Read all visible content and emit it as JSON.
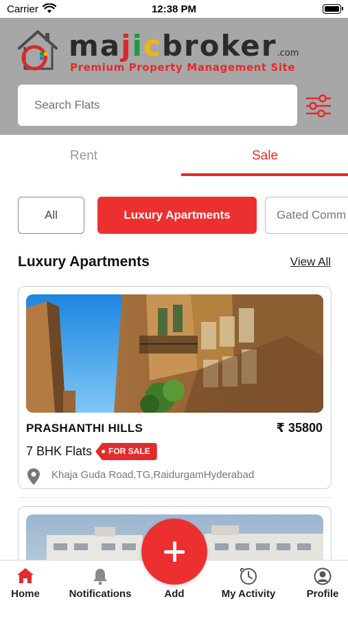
{
  "status_bar": {
    "carrier": "Carrier",
    "time": "12:38 PM"
  },
  "brand": {
    "name_parts": [
      "m",
      "a",
      "j",
      "i",
      "c",
      "broker"
    ],
    "name_a": "ma",
    "name_j": "j",
    "name_i": "i",
    "name_c": "c",
    "name_broker": "broker",
    "dotcom": ".com",
    "tagline": "Premium Property Management Site"
  },
  "search": {
    "placeholder": "Search Flats",
    "value": ""
  },
  "tabs": [
    {
      "label": "Rent",
      "active": false
    },
    {
      "label": "Sale",
      "active": true
    }
  ],
  "categories": [
    {
      "label": "All",
      "active": false
    },
    {
      "label": "Luxury Apartments",
      "active": true
    },
    {
      "label": "Gated Comm",
      "active": false
    }
  ],
  "section": {
    "title": "Luxury Apartments",
    "view_all": "View All"
  },
  "listing": {
    "name": "PRASHANTHI HILLS",
    "price": "₹ 35800",
    "type": "7 BHK Flats",
    "badge": "FOR SALE",
    "location": "Khaja Guda Road,TG,RaidurgamHyderabad"
  },
  "bottom_nav": [
    {
      "label": "Home",
      "icon": "home-icon",
      "active": true
    },
    {
      "label": "Notifications",
      "icon": "bell-icon",
      "active": false
    },
    {
      "label": "Add",
      "icon": "plus-icon",
      "active": false
    },
    {
      "label": "My Activity",
      "icon": "activity-clock-icon",
      "active": false
    },
    {
      "label": "Profile",
      "icon": "user-icon",
      "active": false
    }
  ],
  "colors": {
    "accent": "#E32B2B",
    "header_bg": "#A7A7A7",
    "brand_green": "#1D9A42",
    "brand_yellow": "#F2B50F"
  }
}
